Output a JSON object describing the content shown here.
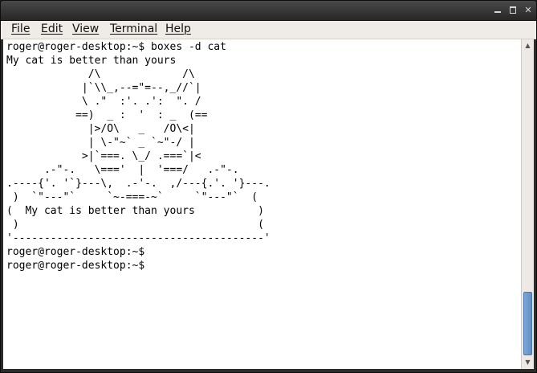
{
  "window": {
    "title": ""
  },
  "menu": {
    "items": [
      {
        "label": "File"
      },
      {
        "label": "Edit"
      },
      {
        "label": "View"
      },
      {
        "label": "Terminal"
      },
      {
        "label": "Help"
      }
    ]
  },
  "terminal": {
    "text": "roger@roger-desktop:~$ boxes -d cat\nMy cat is better than yours\n             /\\             /\\\n            |`\\\\_,--=\"=--,_//`|\n            \\ .\"  :'. .':  \". /\n           ==)  _ :  '  : _  (==\n             |>/O\\   _   /O\\<|\n             | \\-\"~` _ `~\"-/ |\n            >|`===. \\_/ .===`|<\n      .-\"-.   \\==='  |  '===/   .-\"-.\n.----{'. '`}---\\,  .-'-.  ,/---{.'. '}---.\n )  `\"---\"`     `~-===-~`     `\"---\"`  (\n(  My cat is better than yours          )\n )                                      (\n'----------------------------------------'\nroger@roger-desktop:~$\nroger@roger-desktop:~$"
  },
  "scrollbar": {
    "position": 0.79
  }
}
